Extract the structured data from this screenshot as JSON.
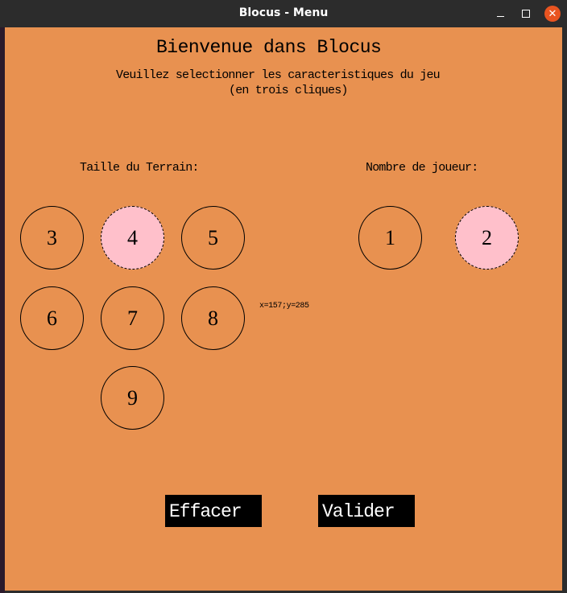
{
  "window": {
    "title": "Blocus - Menu",
    "controls": {
      "minimize": "minimize-icon",
      "maximize": "maximize-icon",
      "close": "close-icon",
      "close_glyph": "✕"
    },
    "background_color": "#e89150",
    "accent_color": "#e95420"
  },
  "menu": {
    "heading": "Bienvenue dans Blocus",
    "subtitle_line1": "Veuillez selectionner les caracteristiques du jeu",
    "subtitle_line2": "(en trois cliques)",
    "terrain_label": "Taille du Terrain:",
    "players_label": "Nombre de joueur:",
    "terrain_sizes": [
      {
        "label": "3",
        "selected": false
      },
      {
        "label": "4",
        "selected": true
      },
      {
        "label": "5",
        "selected": false
      },
      {
        "label": "6",
        "selected": false
      },
      {
        "label": "7",
        "selected": false
      },
      {
        "label": "8",
        "selected": false
      },
      {
        "label": "9",
        "selected": false
      }
    ],
    "player_counts": [
      {
        "label": "1",
        "selected": false
      },
      {
        "label": "2",
        "selected": true
      }
    ],
    "selected_color": "#ffc0cb",
    "cursor_readout": "x=157;y=285",
    "clear_button": "Effacer",
    "validate_button": "Valider"
  }
}
